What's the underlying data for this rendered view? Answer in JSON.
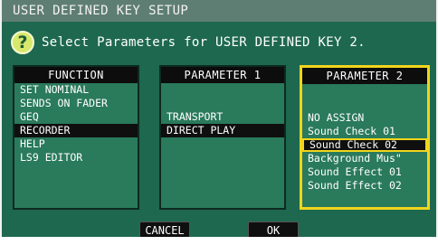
{
  "window": {
    "title": "USER DEFINED KEY SETUP"
  },
  "prompt": {
    "icon": "question-icon",
    "text": "Select Parameters for USER DEFINED KEY 2."
  },
  "columns": [
    {
      "header": "FUNCTION",
      "items": [
        "SET NOMINAL",
        "SENDS ON FADER",
        "GEQ",
        "RECORDER",
        "HELP",
        "LS9 EDITOR"
      ],
      "selected": "RECORDER"
    },
    {
      "header": "PARAMETER 1",
      "items": [
        "TRANSPORT",
        "DIRECT PLAY"
      ],
      "selected": "DIRECT PLAY"
    },
    {
      "header": "PARAMETER 2",
      "items": [
        "NO ASSIGN",
        "Sound Check 01",
        "Sound Check 02",
        "Background Mus\"",
        "Sound Effect 01",
        "Sound Effect 02"
      ],
      "selected": "Sound Check 02"
    }
  ],
  "buttons": {
    "cancel": "CANCEL",
    "ok": "OK"
  },
  "colors": {
    "background": "#1e6850",
    "accent": "#f1d51c",
    "titlebar": "#5f7e73"
  }
}
